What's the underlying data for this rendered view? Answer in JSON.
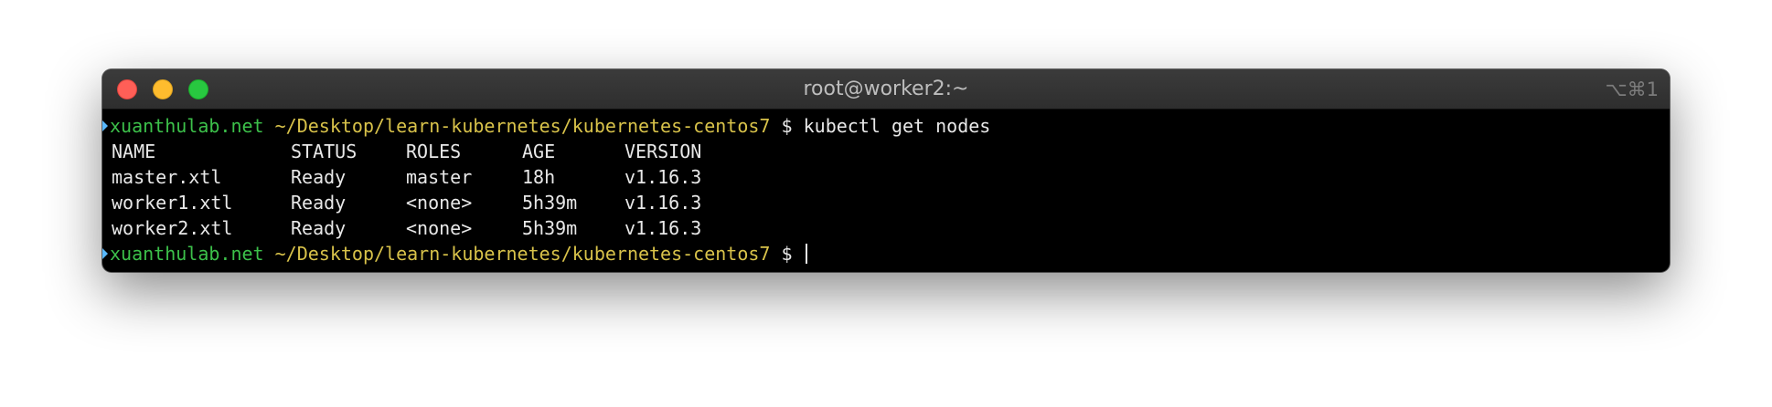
{
  "window": {
    "title": "root@worker2:~",
    "shortcut": "⌥⌘1"
  },
  "terminal": {
    "prompt": {
      "host": "xuanthulab.net",
      "path": "~/Desktop/learn-kubernetes/kubernetes-centos7",
      "symbol": "$"
    },
    "command": "kubectl get nodes",
    "table": {
      "headers": [
        "NAME",
        "STATUS",
        "ROLES",
        "AGE",
        "VERSION"
      ],
      "rows": [
        [
          "master.xtl",
          "Ready",
          "master",
          "18h",
          "v1.16.3"
        ],
        [
          "worker1.xtl",
          "Ready",
          "<none>",
          "5h39m",
          "v1.16.3"
        ],
        [
          "worker2.xtl",
          "Ready",
          "<none>",
          "5h39m",
          "v1.16.3"
        ]
      ]
    }
  },
  "icons": {
    "close": "close-traffic-light-icon",
    "minimize": "minimize-traffic-light-icon",
    "maximize": "maximize-traffic-light-icon",
    "prompt_marker": "prompt-marker-icon"
  },
  "colors": {
    "background": "#000000",
    "host": "#3cc04a",
    "path": "#d8c24a",
    "text": "#e8e8e8",
    "close": "#ff5f57",
    "minimize": "#febc2e",
    "maximize": "#28c840"
  }
}
